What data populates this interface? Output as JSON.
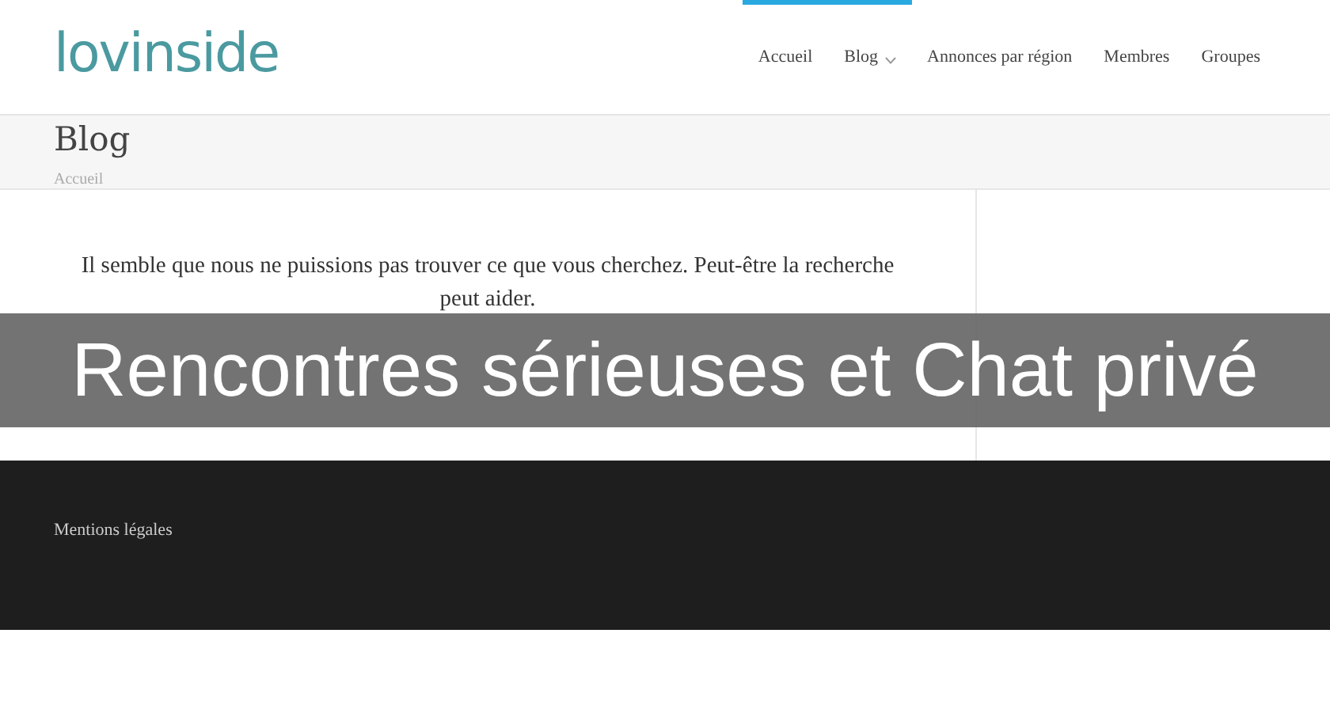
{
  "logo": "lovinside",
  "nav": [
    {
      "label": "Accueil",
      "selected": true,
      "dropdown": false
    },
    {
      "label": "Blog",
      "selected": true,
      "dropdown": true
    },
    {
      "label": "Annonces par région",
      "selected": false,
      "dropdown": false
    },
    {
      "label": "Membres",
      "selected": false,
      "dropdown": false
    },
    {
      "label": "Groupes",
      "selected": false,
      "dropdown": false
    }
  ],
  "page_title": "Blog",
  "breadcrumb": "Accueil",
  "message": "Il semble que nous ne puissions pas trouver ce que vous cherchez. Peut-être la recherche peut aider.",
  "banner": "Rencontres sérieuses et Chat privé",
  "footer": {
    "link": "Mentions légales"
  }
}
